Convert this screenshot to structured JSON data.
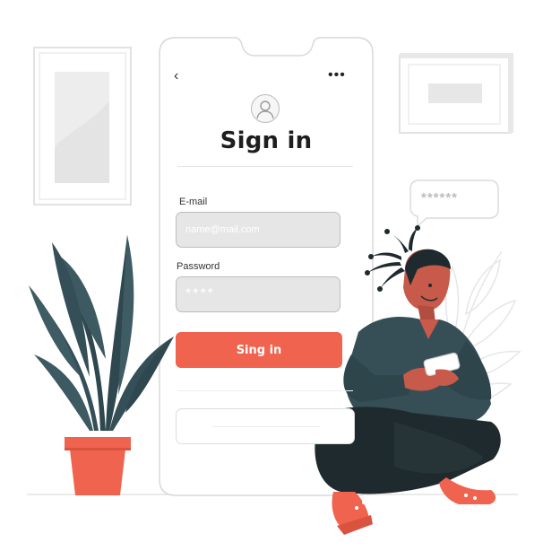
{
  "phone": {
    "back_icon": "chevron-left-icon",
    "more_icon": "more-dots-icon",
    "back_glyph": "‹",
    "more_glyph": "•••",
    "avatar_icon": "user-avatar-icon",
    "title": "Sign in",
    "email_label": "E-mail",
    "email_placeholder": "name@mail.com",
    "password_label": "Password",
    "password_value": "****",
    "signin_button": "Sing in"
  },
  "bubble": {
    "text": "******"
  },
  "colors": {
    "accent": "#f0634e",
    "dark_teal": "#364f57",
    "skin": "#c75a4a",
    "outline": "#dcdcdc"
  }
}
